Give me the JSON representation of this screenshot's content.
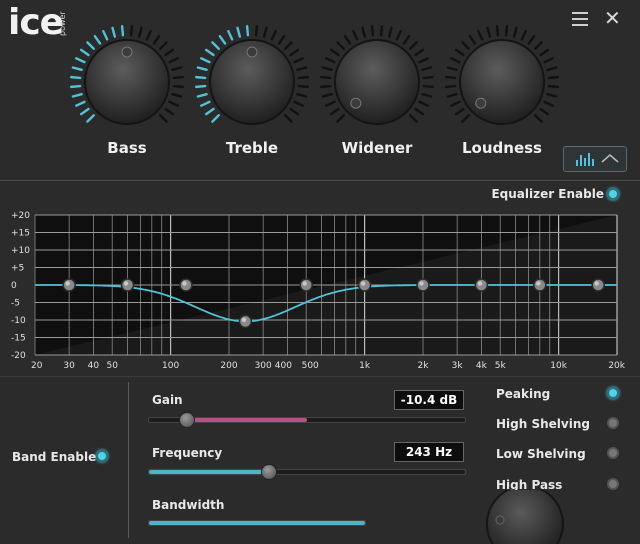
{
  "header": {
    "logo_main": "ice",
    "logo_sub": "power"
  },
  "knobs": [
    {
      "label": "Bass",
      "level": 0.5
    },
    {
      "label": "Treble",
      "level": 0.5
    },
    {
      "label": "Widener",
      "level": 0.0
    },
    {
      "label": "Loudness",
      "level": 0.0
    }
  ],
  "equalizer": {
    "enable_label": "Equalizer Enable",
    "enabled": true,
    "y_labels": [
      "+20",
      "+15",
      "+10",
      "+5",
      "0",
      "-5",
      "-10",
      "-15",
      "-20"
    ],
    "x_labels": [
      "20",
      "30",
      "40",
      "50",
      "100",
      "200",
      "300",
      "400",
      "500",
      "1k",
      "2k",
      "3k",
      "4k",
      "5k",
      "10k",
      "20k"
    ],
    "bands_hz": [
      30,
      60,
      120,
      243,
      500,
      1000,
      2000,
      4000,
      8000,
      16000
    ],
    "bands_db": [
      0,
      0,
      0,
      -10.4,
      0,
      0,
      0,
      0,
      0,
      0
    ],
    "selected_band": 4,
    "accent": "#4fc3d9"
  },
  "band": {
    "enable_label": "Band Enable",
    "enabled": true,
    "gain_label": "Gain",
    "gain_value": "-10.4 dB",
    "gain_level": 0.12,
    "frequency_label": "Frequency",
    "frequency_value": "243 Hz",
    "frequency_level": 0.38,
    "bandwidth_label": "Bandwidth",
    "filters": [
      {
        "label": "Peaking",
        "selected": true
      },
      {
        "label": "High Shelving",
        "selected": false
      },
      {
        "label": "Low Shelving",
        "selected": false
      },
      {
        "label": "High Pass",
        "selected": false
      }
    ]
  }
}
